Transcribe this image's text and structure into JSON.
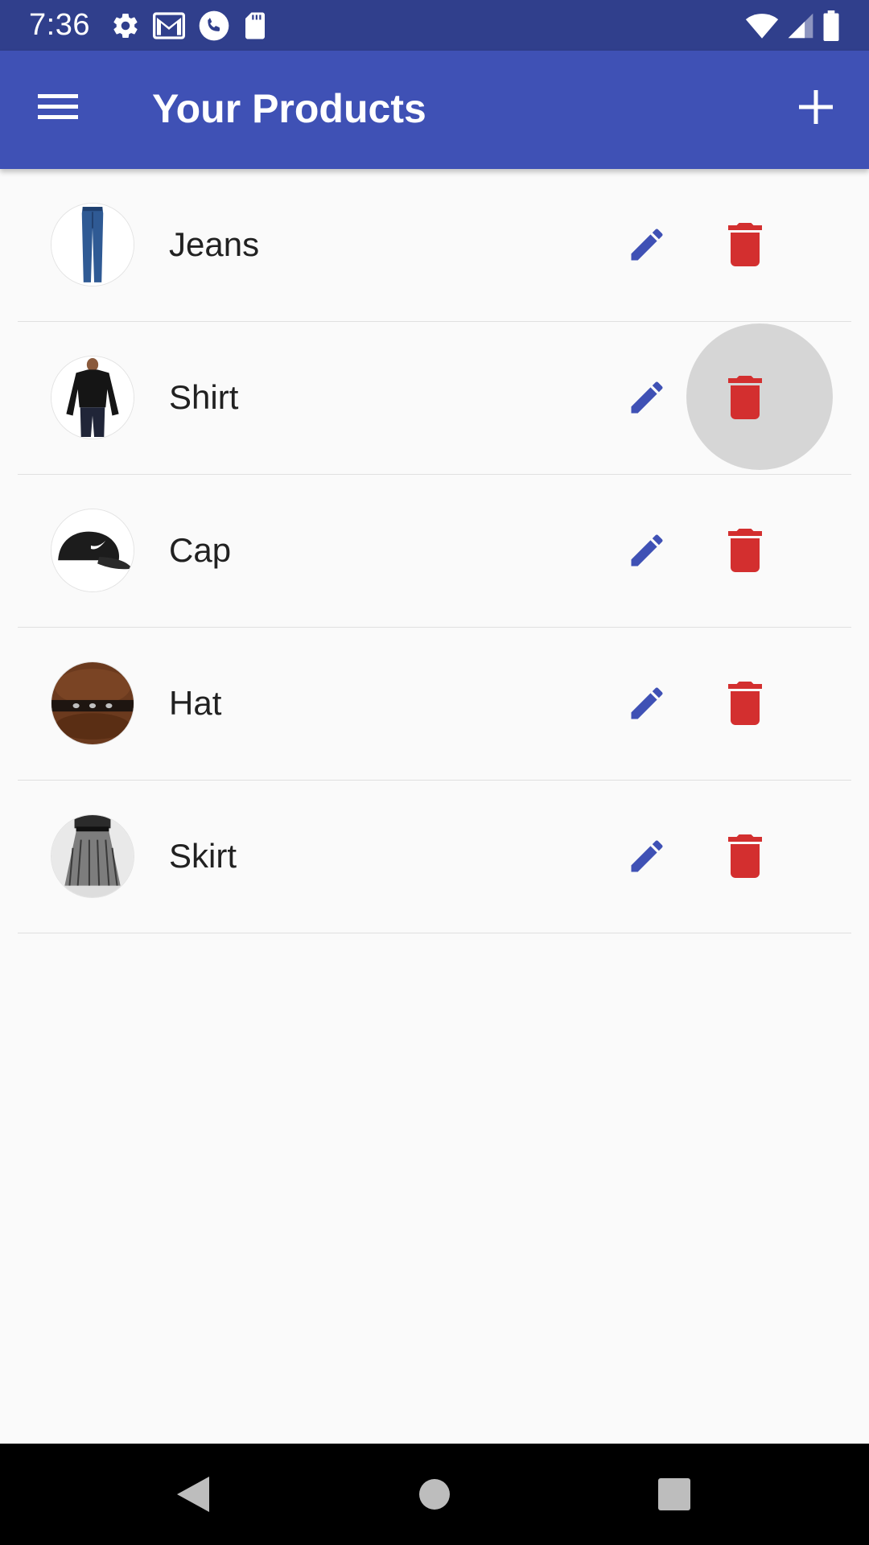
{
  "status_bar": {
    "time": "7:36"
  },
  "app_bar": {
    "title": "Your Products",
    "menu_icon": "menu-icon",
    "add_icon": "add-icon"
  },
  "products": [
    {
      "name": "Jeans",
      "image": "jeans"
    },
    {
      "name": "Shirt",
      "image": "shirt"
    },
    {
      "name": "Cap",
      "image": "cap"
    },
    {
      "name": "Hat",
      "image": "hat"
    },
    {
      "name": "Skirt",
      "image": "skirt"
    }
  ],
  "row_actions": {
    "edit_icon": "edit-icon",
    "delete_icon": "delete-icon"
  },
  "colors": {
    "app_bar": "#3f51b5",
    "status_bar": "#303f8c",
    "edit": "#3f51b5",
    "delete": "#d32f2f",
    "background": "#fafafa"
  }
}
